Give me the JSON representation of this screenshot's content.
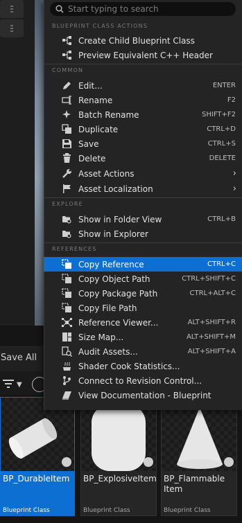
{
  "menu": {
    "search_placeholder": "Start typing to search",
    "sections": [
      {
        "title": "BLUEPRINT CLASS ACTIONS",
        "items": [
          {
            "icon": "child-blueprint-icon",
            "label": "Create Child Blueprint Class",
            "shortcut": ""
          },
          {
            "icon": "cpp-header-icon",
            "label": "Preview Equivalent C++ Header",
            "shortcut": ""
          }
        ]
      },
      {
        "title": "COMMON",
        "items": [
          {
            "icon": "edit-pencil-icon",
            "label": "Edit...",
            "shortcut": "ENTER"
          },
          {
            "icon": "rename-icon",
            "label": "Rename",
            "shortcut": "F2"
          },
          {
            "icon": "batch-rename-icon",
            "label": "Batch Rename",
            "shortcut": "SHIFT+F2"
          },
          {
            "icon": "duplicate-icon",
            "label": "Duplicate",
            "shortcut": "CTRL+D"
          },
          {
            "icon": "save-icon",
            "label": "Save",
            "shortcut": "CTRL+S"
          },
          {
            "icon": "trash-icon",
            "label": "Delete",
            "shortcut": "DELETE"
          },
          {
            "icon": "wrench-icon",
            "label": "Asset Actions",
            "shortcut": "",
            "submenu": true
          },
          {
            "icon": "flag-icon",
            "label": "Asset Localization",
            "shortcut": "",
            "submenu": true
          }
        ]
      },
      {
        "title": "EXPLORE",
        "items": [
          {
            "icon": "folder-search-icon",
            "label": "Show in Folder View",
            "shortcut": "CTRL+B"
          },
          {
            "icon": "explorer-search-icon",
            "label": "Show in Explorer",
            "shortcut": ""
          }
        ]
      },
      {
        "title": "REFERENCES",
        "items": [
          {
            "icon": "copy-reference-icon",
            "label": "Copy Reference",
            "shortcut": "CTRL+C",
            "highlighted": true
          },
          {
            "icon": "copy-object-path-icon",
            "label": "Copy Object Path",
            "shortcut": "CTRL+SHIFT+C"
          },
          {
            "icon": "copy-package-path-icon",
            "label": "Copy Package Path",
            "shortcut": "CTRL+ALT+C"
          },
          {
            "icon": "copy-file-path-icon",
            "label": "Copy File Path",
            "shortcut": ""
          },
          {
            "icon": "reference-viewer-icon",
            "label": "Reference Viewer...",
            "shortcut": "ALT+SHIFT+R"
          },
          {
            "icon": "size-map-icon",
            "label": "Size Map...",
            "shortcut": "ALT+SHIFT+M"
          },
          {
            "icon": "audit-assets-icon",
            "label": "Audit Assets...",
            "shortcut": "ALT+SHIFT+A"
          },
          {
            "icon": "shader-cook-icon",
            "label": "Shader Cook Statistics...",
            "shortcut": ""
          },
          {
            "icon": "revision-control-icon",
            "label": "Connect to Revision Control...",
            "shortcut": ""
          },
          {
            "icon": "documentation-icon",
            "label": "View Documentation - Blueprint",
            "shortcut": ""
          }
        ]
      }
    ]
  },
  "content_browser": {
    "save_all_label": "Save All",
    "assets": [
      {
        "name": "BP_DurableItem",
        "type": "Blueprint Class",
        "selected": true,
        "shape": "cylinder"
      },
      {
        "name": "BP_ExplosiveItem",
        "type": "Blueprint Class",
        "selected": false,
        "shape": "capsule"
      },
      {
        "name": "BP_Flammable Item",
        "type": "Blueprint Class",
        "selected": false,
        "shape": "cone"
      }
    ]
  },
  "colors": {
    "highlight": "#0e6fd3",
    "menu_bg": "#242424"
  }
}
